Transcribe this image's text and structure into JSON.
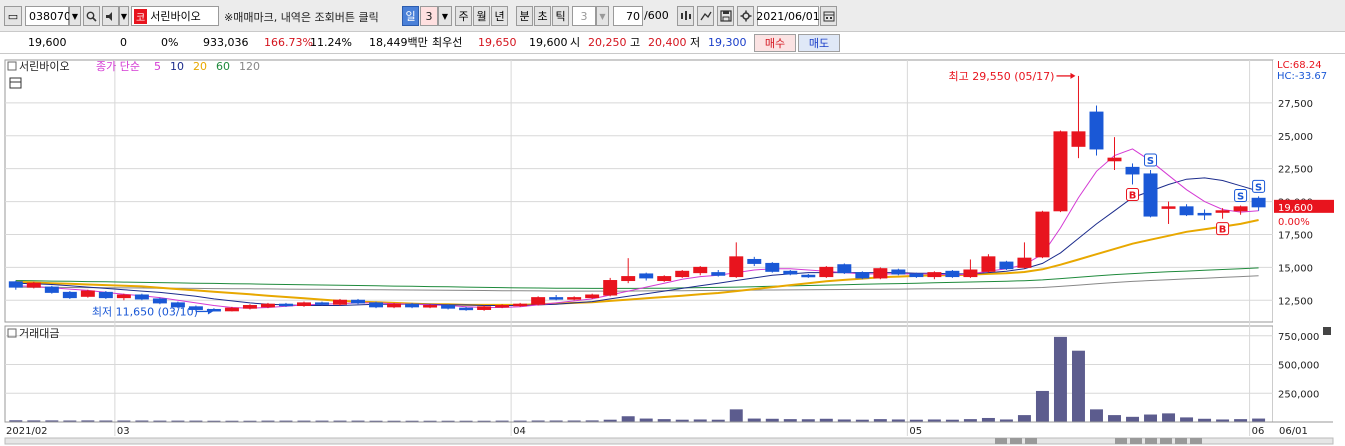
{
  "toolbar": {
    "code": "038070",
    "stock_badge": "코",
    "stock_name": "서린바이오",
    "notice": "※매매마크, 내역은 조회버튼 클릭",
    "period_day": "일",
    "period_num": "3",
    "period_week": "주",
    "period_month": "월",
    "period_year": "년",
    "period_minute": "분",
    "period_second": "초",
    "period_tick": "틱",
    "tick_num": "3",
    "count": "70",
    "count_max": "/600",
    "date": "2021/06/01"
  },
  "quote": {
    "price": "19,600",
    "change": "0",
    "change_pct": "0%",
    "volume": "933,036",
    "pct_a": "166.73%",
    "pct_b": "11.24%",
    "amount": "18,449백만",
    "best_label": "최우선",
    "best_ask": "19,650",
    "best_bid": "19,600",
    "open_label": "시",
    "open": "20,250",
    "high_label": "고",
    "high": "20,400",
    "low_label": "저",
    "low": "19,300",
    "buy": "매수",
    "sell": "매도"
  },
  "colors": {
    "up": "#e8141e",
    "down": "#1a58d6",
    "ma5": "#d43ad4",
    "ma10": "#1c2c8c",
    "ma20": "#e8a800",
    "ma60": "#1f8a3c",
    "ma120": "#888888",
    "volume": "#5c5c8e",
    "grid": "#d8d8d8"
  },
  "chart_data": [
    {
      "type": "candlestick",
      "title": "서린바이오",
      "legend": {
        "prefix": "종가 단순",
        "items": [
          {
            "name": "5",
            "color": "#d43ad4"
          },
          {
            "name": "10",
            "color": "#1c2c8c"
          },
          {
            "name": "20",
            "color": "#e8a800"
          },
          {
            "name": "60",
            "color": "#1f8a3c"
          },
          {
            "name": "120",
            "color": "#888888"
          }
        ]
      },
      "y_ticks": [
        "27,500",
        "25,000",
        "22,500",
        "20,000",
        "17,500",
        "15,000",
        "12,500"
      ],
      "y_tick_values": [
        27500,
        25000,
        22500,
        20000,
        17500,
        15000,
        12500
      ],
      "ylim": [
        11000,
        30000
      ],
      "x_labels": [
        "2021/02",
        "03",
        "04",
        "05",
        "06",
        "06/01"
      ],
      "indicators": {
        "lc": "LC:68.24",
        "hc": "HC:-33.67"
      },
      "current_price": "19,600",
      "current_pct": "0.00%",
      "annotation_high": "최고 29,550 (05/17)",
      "annotation_low": "최저 11,650 (03/10)",
      "candles": [
        {
          "o": 13900,
          "c": 13500,
          "h": 14000,
          "l": 13300
        },
        {
          "o": 13500,
          "c": 13800,
          "h": 13900,
          "l": 13400
        },
        {
          "o": 13500,
          "c": 13100,
          "h": 13600,
          "l": 13000
        },
        {
          "o": 13100,
          "c": 12700,
          "h": 13200,
          "l": 12600
        },
        {
          "o": 12800,
          "c": 13200,
          "h": 13300,
          "l": 12700
        },
        {
          "o": 13100,
          "c": 12700,
          "h": 13200,
          "l": 12600
        },
        {
          "o": 12700,
          "c": 12900,
          "h": 13000,
          "l": 12500
        },
        {
          "o": 12900,
          "c": 12600,
          "h": 13000,
          "l": 12500
        },
        {
          "o": 12600,
          "c": 12300,
          "h": 12700,
          "l": 12200
        },
        {
          "o": 12300,
          "c": 12000,
          "h": 12400,
          "l": 11900
        },
        {
          "o": 12000,
          "c": 11800,
          "h": 12100,
          "l": 11650
        },
        {
          "o": 11800,
          "c": 11700,
          "h": 11900,
          "l": 11650
        },
        {
          "o": 11700,
          "c": 11900,
          "h": 12000,
          "l": 11650
        },
        {
          "o": 11900,
          "c": 12100,
          "h": 12200,
          "l": 11800
        },
        {
          "o": 12000,
          "c": 12200,
          "h": 12300,
          "l": 11900
        },
        {
          "o": 12200,
          "c": 12100,
          "h": 12300,
          "l": 12000
        },
        {
          "o": 12100,
          "c": 12300,
          "h": 12400,
          "l": 12000
        },
        {
          "o": 12300,
          "c": 12200,
          "h": 12400,
          "l": 12100
        },
        {
          "o": 12200,
          "c": 12500,
          "h": 12600,
          "l": 12100
        },
        {
          "o": 12500,
          "c": 12300,
          "h": 12600,
          "l": 12200
        },
        {
          "o": 12300,
          "c": 12000,
          "h": 12400,
          "l": 11900
        },
        {
          "o": 12000,
          "c": 12200,
          "h": 12300,
          "l": 11900
        },
        {
          "o": 12200,
          "c": 12000,
          "h": 12300,
          "l": 11900
        },
        {
          "o": 12000,
          "c": 12100,
          "h": 12200,
          "l": 11900
        },
        {
          "o": 12100,
          "c": 11900,
          "h": 12200,
          "l": 11800
        },
        {
          "o": 11900,
          "c": 11800,
          "h": 12000,
          "l": 11700
        },
        {
          "o": 11800,
          "c": 12000,
          "h": 12100,
          "l": 11700
        },
        {
          "o": 12000,
          "c": 12100,
          "h": 12200,
          "l": 11900
        },
        {
          "o": 12100,
          "c": 12200,
          "h": 12300,
          "l": 12000
        },
        {
          "o": 12200,
          "c": 12700,
          "h": 12800,
          "l": 12100
        },
        {
          "o": 12700,
          "c": 12600,
          "h": 12900,
          "l": 12500
        },
        {
          "o": 12600,
          "c": 12700,
          "h": 12800,
          "l": 12500
        },
        {
          "o": 12700,
          "c": 12900,
          "h": 13000,
          "l": 12600
        },
        {
          "o": 12900,
          "c": 14000,
          "h": 14200,
          "l": 12800
        },
        {
          "o": 14000,
          "c": 14300,
          "h": 15700,
          "l": 13800
        },
        {
          "o": 14500,
          "c": 14200,
          "h": 14600,
          "l": 14000
        },
        {
          "o": 14000,
          "c": 14300,
          "h": 14400,
          "l": 13900
        },
        {
          "o": 14300,
          "c": 14700,
          "h": 14800,
          "l": 14200
        },
        {
          "o": 14600,
          "c": 15000,
          "h": 15100,
          "l": 14400
        },
        {
          "o": 14600,
          "c": 14400,
          "h": 14800,
          "l": 14300
        },
        {
          "o": 14300,
          "c": 15800,
          "h": 16900,
          "l": 14200
        },
        {
          "o": 15600,
          "c": 15300,
          "h": 15800,
          "l": 15100
        },
        {
          "o": 15300,
          "c": 14700,
          "h": 15400,
          "l": 14600
        },
        {
          "o": 14700,
          "c": 14500,
          "h": 14800,
          "l": 14400
        },
        {
          "o": 14400,
          "c": 14300,
          "h": 14500,
          "l": 14200
        },
        {
          "o": 14300,
          "c": 15000,
          "h": 15100,
          "l": 14200
        },
        {
          "o": 15200,
          "c": 14600,
          "h": 15300,
          "l": 14500
        },
        {
          "o": 14600,
          "c": 14200,
          "h": 14700,
          "l": 14100
        },
        {
          "o": 14200,
          "c": 14900,
          "h": 15000,
          "l": 14100
        },
        {
          "o": 14800,
          "c": 14500,
          "h": 14900,
          "l": 14400
        },
        {
          "o": 14500,
          "c": 14300,
          "h": 14600,
          "l": 14200
        },
        {
          "o": 14300,
          "c": 14600,
          "h": 14700,
          "l": 14100
        },
        {
          "o": 14700,
          "c": 14300,
          "h": 14800,
          "l": 14200
        },
        {
          "o": 14300,
          "c": 14800,
          "h": 15600,
          "l": 14200
        },
        {
          "o": 14700,
          "c": 15800,
          "h": 16000,
          "l": 14600
        },
        {
          "o": 15400,
          "c": 14900,
          "h": 15500,
          "l": 14800
        },
        {
          "o": 15000,
          "c": 15700,
          "h": 16900,
          "l": 14900
        },
        {
          "o": 15800,
          "c": 19200,
          "h": 19300,
          "l": 15700
        },
        {
          "o": 19300,
          "c": 25300,
          "h": 25400,
          "l": 19200
        },
        {
          "o": 24200,
          "c": 25300,
          "h": 29550,
          "l": 23300
        },
        {
          "o": 26800,
          "c": 24000,
          "h": 27300,
          "l": 23500
        },
        {
          "o": 23100,
          "c": 23300,
          "h": 24900,
          "l": 22400
        },
        {
          "o": 22600,
          "c": 22100,
          "h": 22900,
          "l": 21300
        },
        {
          "o": 22100,
          "c": 18900,
          "h": 22400,
          "l": 18800
        },
        {
          "o": 19500,
          "c": 19600,
          "h": 20000,
          "l": 18300
        },
        {
          "o": 19600,
          "c": 19000,
          "h": 19800,
          "l": 18900
        },
        {
          "o": 19100,
          "c": 19000,
          "h": 19400,
          "l": 18600
        },
        {
          "o": 19200,
          "c": 19300,
          "h": 19500,
          "l": 18700
        },
        {
          "o": 19300,
          "c": 19600,
          "h": 19700,
          "l": 19000
        },
        {
          "o": 20250,
          "c": 19600,
          "h": 20400,
          "l": 19300
        }
      ],
      "ma5": [
        13600,
        13550,
        13450,
        13350,
        13250,
        13100,
        12950,
        12850,
        12700,
        12500,
        12300,
        12100,
        11950,
        11900,
        11950,
        12050,
        12150,
        12200,
        12250,
        12300,
        12300,
        12250,
        12200,
        12150,
        12100,
        12000,
        11950,
        11950,
        12000,
        12150,
        12300,
        12450,
        12600,
        12900,
        13200,
        13500,
        13800,
        14100,
        14300,
        14400,
        14600,
        14800,
        14900,
        14900,
        14800,
        14700,
        14600,
        14500,
        14500,
        14500,
        14500,
        14500,
        14400,
        14500,
        14700,
        14900,
        15200,
        16000,
        18000,
        20300,
        22300,
        23500,
        24000,
        23100,
        22000,
        20900,
        20000,
        19400,
        19200,
        19300
      ],
      "ma10": [
        13800,
        13750,
        13700,
        13600,
        13500,
        13400,
        13300,
        13200,
        13100,
        12950,
        12800,
        12600,
        12450,
        12300,
        12200,
        12150,
        12100,
        12100,
        12100,
        12150,
        12200,
        12200,
        12200,
        12200,
        12150,
        12150,
        12100,
        12100,
        12100,
        12150,
        12200,
        12300,
        12400,
        12600,
        12800,
        13000,
        13200,
        13400,
        13600,
        13800,
        14000,
        14200,
        14400,
        14500,
        14600,
        14600,
        14600,
        14600,
        14600,
        14600,
        14550,
        14550,
        14500,
        14500,
        14600,
        14700,
        14900,
        15300,
        16100,
        17200,
        18300,
        19300,
        20300,
        20800,
        21300,
        21700,
        21800,
        21600,
        21200,
        20800
      ],
      "ma20": [
        13900,
        13850,
        13800,
        13750,
        13700,
        13650,
        13600,
        13550,
        13450,
        13350,
        13250,
        13150,
        13050,
        12950,
        12850,
        12750,
        12650,
        12550,
        12450,
        12400,
        12350,
        12300,
        12250,
        12200,
        12200,
        12150,
        12150,
        12150,
        12150,
        12200,
        12250,
        12300,
        12350,
        12450,
        12550,
        12650,
        12750,
        12850,
        12950,
        13050,
        13200,
        13350,
        13500,
        13650,
        13800,
        13950,
        14050,
        14150,
        14250,
        14300,
        14350,
        14400,
        14400,
        14450,
        14500,
        14550,
        14650,
        14850,
        15200,
        15600,
        16000,
        16400,
        16800,
        17100,
        17400,
        17700,
        17900,
        18100,
        18300,
        18600
      ],
      "ma60": [
        14000,
        13980,
        13960,
        13940,
        13920,
        13900,
        13880,
        13860,
        13840,
        13820,
        13800,
        13780,
        13760,
        13740,
        13720,
        13700,
        13680,
        13660,
        13640,
        13620,
        13600,
        13580,
        13560,
        13540,
        13520,
        13500,
        13480,
        13460,
        13440,
        13430,
        13420,
        13410,
        13400,
        13400,
        13400,
        13410,
        13420,
        13440,
        13460,
        13480,
        13500,
        13530,
        13560,
        13590,
        13620,
        13650,
        13680,
        13710,
        13740,
        13770,
        13800,
        13830,
        13860,
        13890,
        13920,
        13950,
        13990,
        14050,
        14150,
        14250,
        14350,
        14450,
        14530,
        14600,
        14660,
        14720,
        14780,
        14840,
        14900,
        14960
      ],
      "ma120": [
        13500,
        13490,
        13480,
        13470,
        13460,
        13450,
        13440,
        13430,
        13420,
        13410,
        13400,
        13390,
        13380,
        13370,
        13360,
        13350,
        13340,
        13330,
        13320,
        13310,
        13300,
        13290,
        13280,
        13270,
        13260,
        13250,
        13240,
        13230,
        13220,
        13210,
        13200,
        13200,
        13200,
        13200,
        13200,
        13210,
        13220,
        13230,
        13240,
        13250,
        13260,
        13270,
        13280,
        13290,
        13300,
        13310,
        13320,
        13330,
        13340,
        13350,
        13360,
        13370,
        13380,
        13390,
        13400,
        13410,
        13430,
        13470,
        13550,
        13650,
        13750,
        13850,
        13930,
        14000,
        14060,
        14120,
        14180,
        14240,
        14300,
        14360
      ],
      "markers": [
        {
          "index": 63,
          "kind": "S",
          "position": "above"
        },
        {
          "index": 62,
          "kind": "B",
          "position": "below"
        },
        {
          "index": 68,
          "kind": "S",
          "position": "above"
        },
        {
          "index": 67,
          "kind": "B",
          "position": "below"
        },
        {
          "index": 69,
          "kind": "S",
          "position": "above"
        }
      ]
    },
    {
      "type": "bar",
      "title": "거래대금",
      "y_ticks": [
        "750,000",
        "500,000",
        "250,000"
      ],
      "y_tick_values": [
        750000,
        500000,
        250000
      ],
      "ylim": [
        0,
        800000
      ],
      "values": [
        15000,
        14000,
        14000,
        13000,
        14000,
        13000,
        13000,
        13000,
        12000,
        12000,
        12000,
        11000,
        11000,
        11000,
        12000,
        12000,
        12000,
        12000,
        12000,
        12000,
        11000,
        11000,
        11000,
        11000,
        11000,
        11000,
        11000,
        12000,
        12000,
        13000,
        13000,
        13000,
        14000,
        20000,
        50000,
        30000,
        25000,
        20000,
        22000,
        20000,
        110000,
        30000,
        28000,
        25000,
        24000,
        28000,
        22000,
        20000,
        25000,
        22000,
        20000,
        22000,
        20000,
        25000,
        35000,
        22000,
        60000,
        270000,
        740000,
        620000,
        110000,
        60000,
        45000,
        65000,
        75000,
        40000,
        28000,
        22000,
        25000,
        30000
      ]
    }
  ]
}
